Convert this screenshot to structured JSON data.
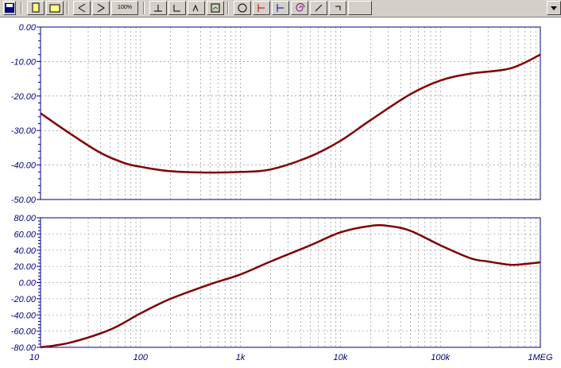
{
  "toolbar": {
    "icons": [
      "save-icon",
      "new-file-icon",
      "open-file-icon",
      "zoom-in-icon",
      "zoom-out-icon",
      "zoom-100-icon",
      "cursor-a-icon",
      "cursor-b-icon",
      "cursor-c-icon",
      "graph-settings-icon",
      "circle-marker-icon",
      "trace-cursor-red-icon",
      "trace-cursor-blue-icon",
      "spiral-icon",
      "pen-icon",
      "undo-icon",
      "dropdown-arrow-icon"
    ],
    "zoom_label": "100%"
  },
  "colors": {
    "trace": "#800000",
    "axis_text": "#000080",
    "grid": "#808080",
    "frame": "#000080",
    "toolbar_bg": "#d4d0c8"
  },
  "chart_data": [
    {
      "type": "line",
      "x_scale": "log",
      "xlim": [
        10,
        1000000
      ],
      "ylim": [
        -50,
        0
      ],
      "yticks": [
        "0.00",
        "-10.00",
        "-20.00",
        "-30.00",
        "-40.00",
        "-50.00"
      ],
      "grid": true,
      "series": [
        {
          "x": [
            10,
            20,
            40,
            70,
            100,
            200,
            500,
            1000,
            2000,
            5000,
            10000,
            20000,
            50000,
            100000,
            200000,
            500000,
            1000000
          ],
          "values": [
            -25,
            -31,
            -36.5,
            -39.5,
            -40.5,
            -41.8,
            -42.2,
            -42,
            -41.3,
            -37.5,
            -33,
            -27,
            -19.5,
            -15.5,
            -13.5,
            -12,
            -8
          ]
        }
      ]
    },
    {
      "type": "line",
      "x_scale": "log",
      "xlim": [
        10,
        1000000
      ],
      "ylim": [
        -80,
        80
      ],
      "yticks": [
        "80.00",
        "60.00",
        "40.00",
        "20.00",
        "0.00",
        "-20.00",
        "-40.00",
        "-60.00",
        "-80.00"
      ],
      "xticks": [
        "10",
        "100",
        "1k",
        "10k",
        "100k",
        "1MEG"
      ],
      "grid": true,
      "series": [
        {
          "x": [
            10,
            20,
            50,
            100,
            200,
            500,
            1000,
            2000,
            5000,
            10000,
            20000,
            30000,
            50000,
            100000,
            200000,
            300000,
            500000,
            700000,
            1000000
          ],
          "values": [
            -80,
            -74,
            -58,
            -38,
            -20,
            -2,
            10,
            26,
            46,
            62,
            70,
            70,
            64,
            46,
            30,
            26,
            22,
            23,
            25
          ]
        }
      ]
    }
  ]
}
